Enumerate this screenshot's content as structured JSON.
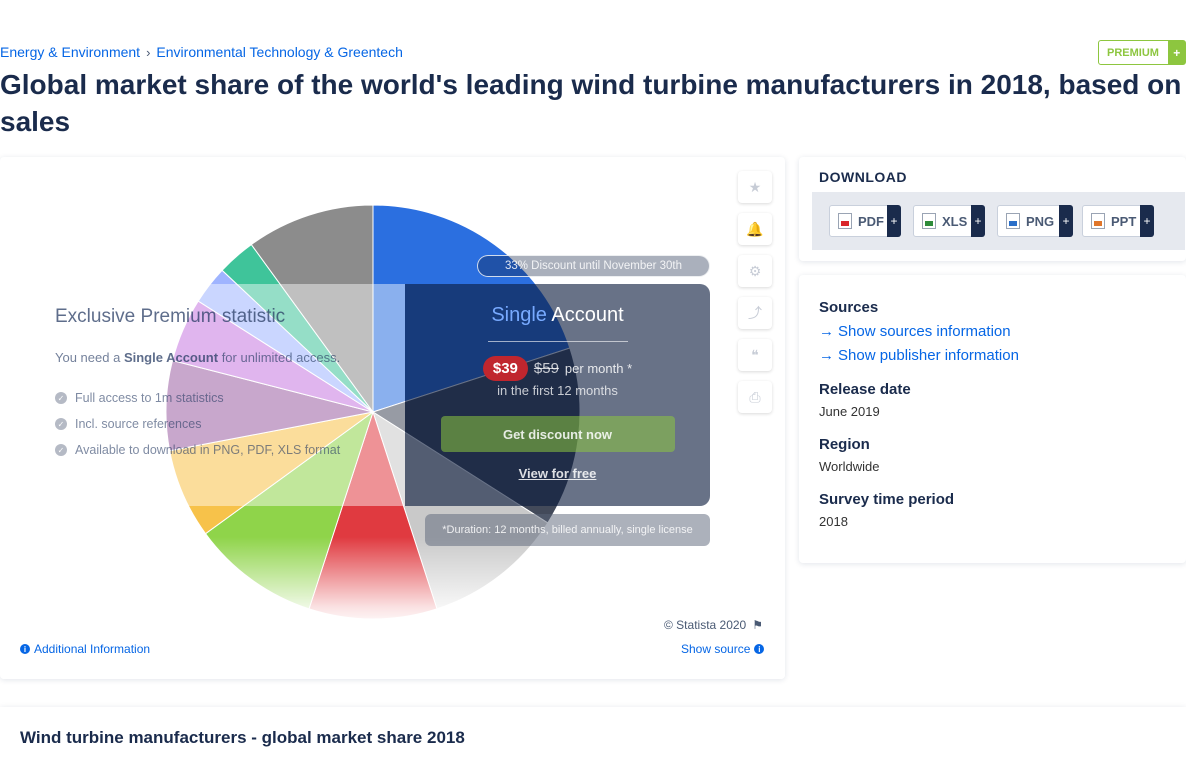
{
  "breadcrumb": {
    "items": [
      "Energy & Environment",
      "Environmental Technology & Greentech"
    ],
    "separator": "›"
  },
  "premium_badge": {
    "label": "PREMIUM",
    "plus": "+"
  },
  "title": "Global market share of the world's leading wind turbine manufacturers in 2018, based on sales",
  "tools": {
    "icons": [
      "star-icon",
      "bell-icon",
      "gear-icon",
      "share-icon",
      "quote-icon",
      "print-icon"
    ],
    "glyphs": [
      "★",
      "🔔",
      "⚙",
      "⤴",
      "❝",
      "⎙"
    ]
  },
  "premium_overlay": {
    "discount_tag": "33% Discount until November 30th",
    "heading": "Exclusive Premium statistic",
    "need_prefix": "You need a ",
    "need_bold": "Single Account",
    "need_suffix": " for unlimited access.",
    "features": [
      "Full access to 1m statistics",
      "Incl. source references",
      "Available to download in PNG, PDF, XLS format"
    ],
    "account_word1": "Single",
    "account_word2": "Account",
    "price_new": "$39",
    "price_old": "$59",
    "per_month": "per month *",
    "first_months": "in the first 12 months",
    "cta": "Get discount now",
    "view_free": "View for free",
    "duration": "*Duration: 12 months, billed annually, single license"
  },
  "footer": {
    "copyright": "© Statista 2020",
    "additional_info": "Additional Information",
    "show_source": "Show source"
  },
  "download": {
    "title": "DOWNLOAD",
    "formats": [
      {
        "label": "PDF",
        "color": "#d9262b"
      },
      {
        "label": "XLS",
        "color": "#2e8b3a"
      },
      {
        "label": "PNG",
        "color": "#2a6fc9"
      },
      {
        "label": "PPT",
        "color": "#e0762b"
      }
    ],
    "plus": "+"
  },
  "meta": {
    "sources_label": "Sources",
    "show_sources": "Show sources information",
    "show_publisher": "Show publisher information",
    "release_label": "Release date",
    "release_value": "June 2019",
    "region_label": "Region",
    "region_value": "Worldwide",
    "survey_label": "Survey time period",
    "survey_value": "2018"
  },
  "bottom": {
    "title": "Wind turbine manufacturers - global market share 2018"
  },
  "chart_data": {
    "type": "pie",
    "slice_colors": [
      "#2b6fe0",
      "#434a5a",
      "#c9c9c9",
      "#e03a40",
      "#8fd44a",
      "#f7c24a",
      "#9b5fa3",
      "#c678e0",
      "#9fb4ff",
      "#3fc49a",
      "#8c8c8c"
    ],
    "values": [
      20,
      14,
      11,
      10,
      10,
      7,
      7,
      5,
      3,
      3,
      10
    ]
  }
}
